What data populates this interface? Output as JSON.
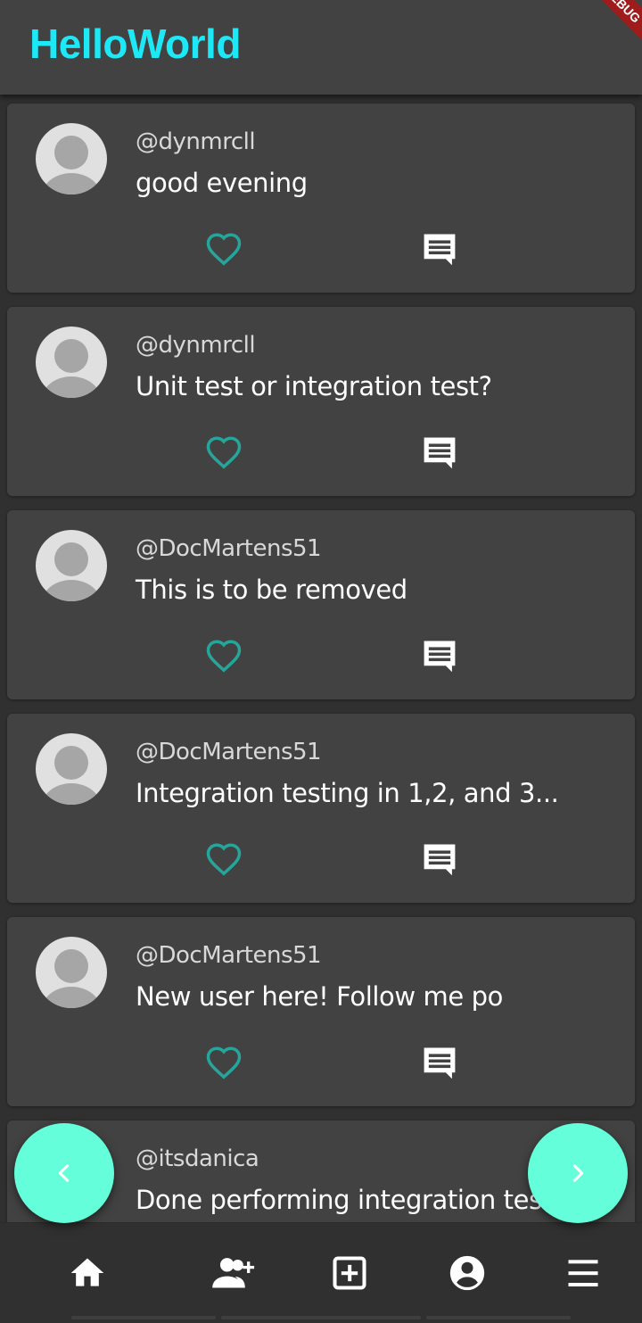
{
  "app": {
    "title": "HelloWorld",
    "debug_banner": "DEBUG"
  },
  "posts": [
    {
      "username": "@dynmrcll",
      "message": "good evening"
    },
    {
      "username": "@dynmrcll",
      "message": "Unit test or integration test?"
    },
    {
      "username": "@DocMartens51",
      "message": "This is to be removed"
    },
    {
      "username": "@DocMartens51",
      "message": "Integration testing in 1,2, and 3..."
    },
    {
      "username": "@DocMartens51",
      "message": "New user here! Follow me po"
    },
    {
      "username": "@itsdanica",
      "message": "Done performing integration tes"
    }
  ],
  "pagination": {
    "prev_icon": "chevron-left-icon",
    "next_icon": "chevron-right-icon"
  },
  "bottom_nav": {
    "items": [
      {
        "icon": "home-icon"
      },
      {
        "icon": "add-friend-icon"
      },
      {
        "icon": "add-post-icon"
      },
      {
        "icon": "account-icon"
      },
      {
        "icon": "menu-icon"
      }
    ]
  },
  "colors": {
    "title": "#1de9f6",
    "accent": "#64ffda",
    "like": "#26a69a",
    "card": "#424242",
    "background": "#303030"
  }
}
